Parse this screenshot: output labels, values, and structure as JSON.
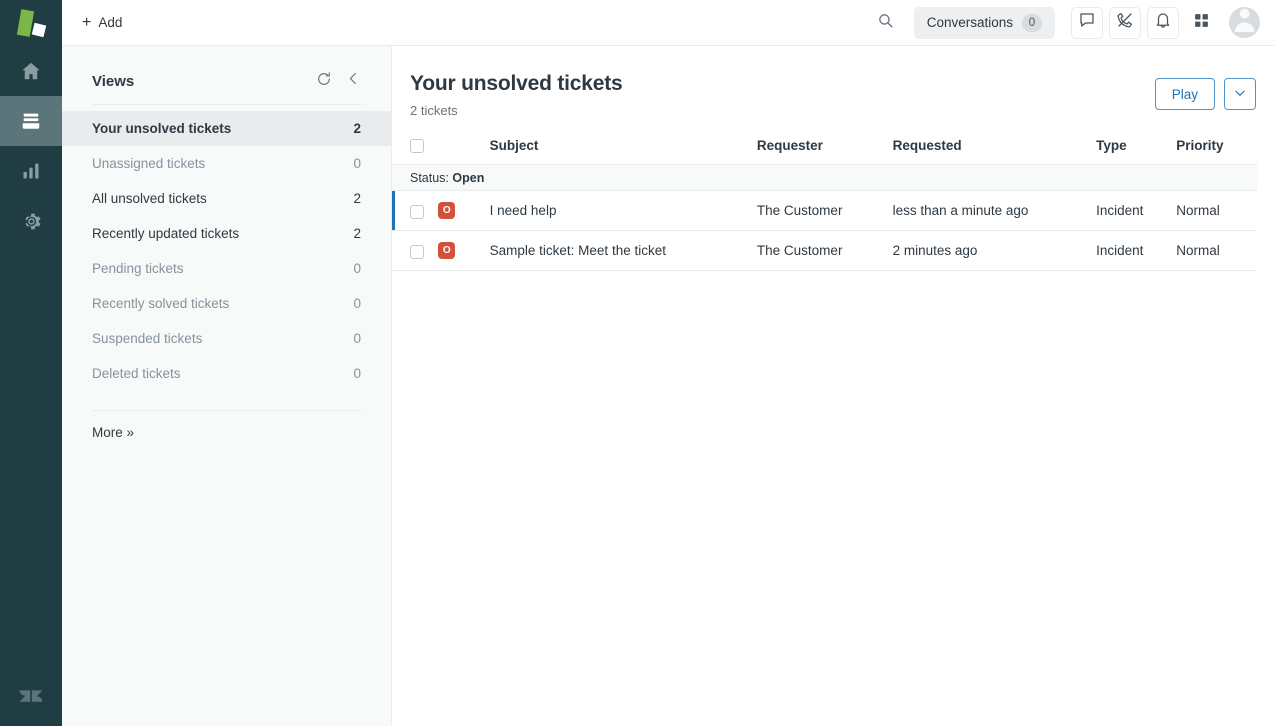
{
  "brand": {
    "logo_icon": "brand-logo",
    "footer_logo_icon": "zendesk-logo"
  },
  "rail": {
    "items": [
      {
        "icon": "home-icon",
        "name": "home",
        "active": false
      },
      {
        "icon": "views-icon",
        "name": "views",
        "active": true
      },
      {
        "icon": "reporting-icon",
        "name": "reporting",
        "active": false
      },
      {
        "icon": "settings-gear-icon",
        "name": "settings",
        "active": false
      }
    ]
  },
  "topbar": {
    "add_label": "Add",
    "add_icon": "plus-icon",
    "search_icon": "search-icon",
    "conversations_label": "Conversations",
    "conversations_count": "0",
    "chat_icon": "chat-bubble-icon",
    "phone_icon": "phone-icon",
    "bell_icon": "bell-icon",
    "apps_icon": "grid-apps-icon",
    "avatar_icon": "user-avatar-icon"
  },
  "sidebar": {
    "title": "Views",
    "refresh_icon": "refresh-icon",
    "collapse_icon": "chevron-left-icon",
    "more_label": "More »",
    "items": [
      {
        "label": "Your unsolved tickets",
        "count": "2",
        "selected": true,
        "muted": false
      },
      {
        "label": "Unassigned tickets",
        "count": "0",
        "selected": false,
        "muted": true
      },
      {
        "label": "All unsolved tickets",
        "count": "2",
        "selected": false,
        "muted": false
      },
      {
        "label": "Recently updated tickets",
        "count": "2",
        "selected": false,
        "muted": false
      },
      {
        "label": "Pending tickets",
        "count": "0",
        "selected": false,
        "muted": true
      },
      {
        "label": "Recently solved tickets",
        "count": "0",
        "selected": false,
        "muted": true
      },
      {
        "label": "Suspended tickets",
        "count": "0",
        "selected": false,
        "muted": true
      },
      {
        "label": "Deleted tickets",
        "count": "0",
        "selected": false,
        "muted": true
      }
    ]
  },
  "main": {
    "title": "Your unsolved tickets",
    "subtitle": "2 tickets",
    "play_label": "Play",
    "caret_icon": "chevron-down-icon",
    "table": {
      "columns": [
        "",
        "",
        "Subject",
        "Requester",
        "Requested",
        "Type",
        "Priority"
      ],
      "headers": {
        "subject": "Subject",
        "requester": "Requester",
        "requested": "Requested",
        "type": "Type",
        "priority": "Priority"
      },
      "group_label": "Status:",
      "group_value": "Open",
      "rows": [
        {
          "status_badge": "O",
          "subject": "I need help",
          "requester": "The Customer",
          "requested": "less than a minute ago",
          "type": "Incident",
          "priority": "Normal",
          "selected_marker": true
        },
        {
          "status_badge": "O",
          "subject": "Sample ticket: Meet the ticket",
          "requester": "The Customer",
          "requested": "2 minutes ago",
          "type": "Incident",
          "priority": "Normal",
          "selected_marker": false
        }
      ]
    }
  },
  "colors": {
    "rail_bg": "#1f3d42",
    "rail_active": "#5b757a",
    "accent_blue": "#1f73b7",
    "status_open": "#d4503b",
    "brand_green": "#7ab648",
    "sidebar_bg": "#f8f9f9",
    "selected_bg": "#e9ebed",
    "text": "#2f3941",
    "muted_text": "#87929d"
  }
}
